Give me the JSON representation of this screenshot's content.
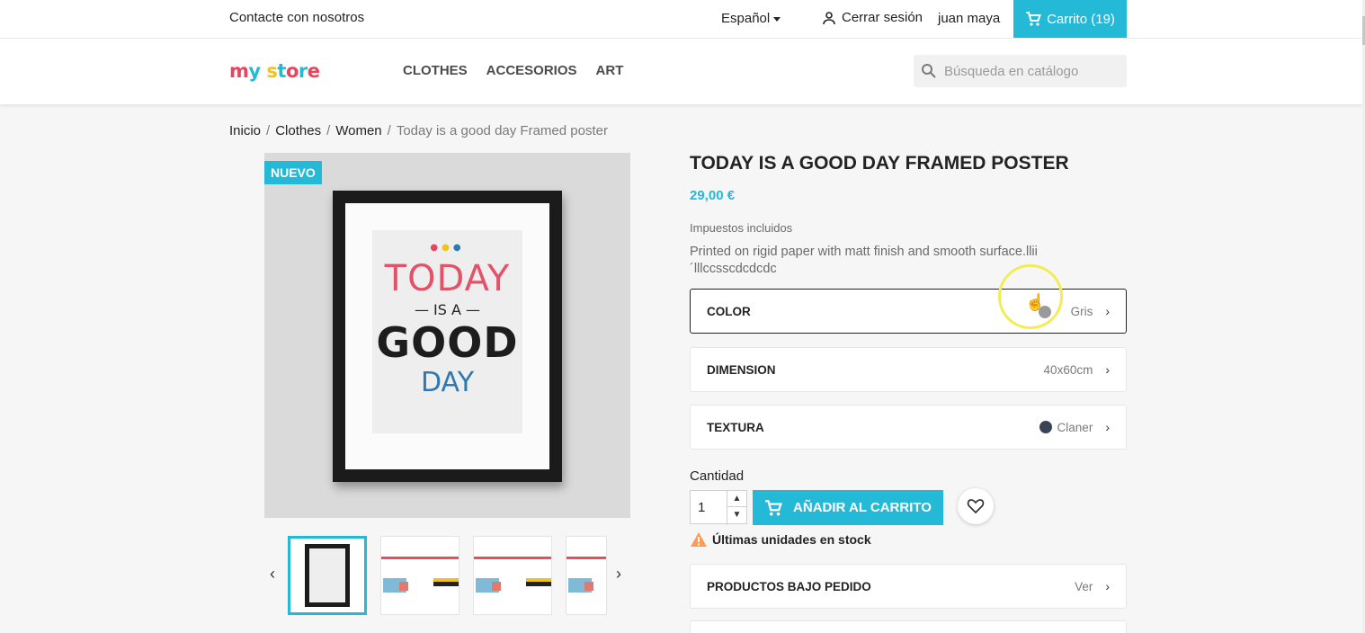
{
  "topbar": {
    "contact": "Contacte con nosotros",
    "language": "Español",
    "logout": "Cerrar sesión",
    "username": "juan maya",
    "cart": "Carrito (19)"
  },
  "header": {
    "logo": "my store",
    "nav": [
      "CLOTHES",
      "ACCESORIOS",
      "ART"
    ],
    "search_placeholder": "Búsqueda en catálogo"
  },
  "breadcrumb": [
    "Inicio",
    "Clothes",
    "Women",
    "Today is a good day Framed poster"
  ],
  "product": {
    "badge": "NUEVO",
    "title": "TODAY IS A GOOD DAY FRAMED POSTER",
    "price": "29,00 €",
    "tax": "Impuestos incluidos",
    "description_line1": "Printed on rigid paper with matt finish and smooth surface.llii",
    "description_line2": "´lllccsscdcdcdc",
    "artwork": {
      "line1": "TODAY",
      "line2": "— IS A —",
      "line3": "GOOD",
      "line4": "DAY"
    },
    "options": [
      {
        "label": "COLOR",
        "value": "Gris",
        "swatch": "#9a9a9a"
      },
      {
        "label": "DIMENSION",
        "value": "40x60cm"
      },
      {
        "label": "TEXTURA",
        "value": "Claner",
        "swatch": "#3b4356"
      }
    ],
    "quantity_label": "Cantidad",
    "quantity": "1",
    "add_to_cart": "AÑADIR AL CARRITO",
    "stock_warning": "Últimas unidades en stock",
    "backorder": {
      "label": "PRODUCTOS BAJO PEDIDO",
      "value": "Ver"
    }
  },
  "colors": {
    "accent": "#24b9d7",
    "logo_m": "#e5465d",
    "logo_y": "#24b9d7",
    "warning": "#ff9a52"
  },
  "icons": {
    "user": "user-icon",
    "cart": "cart-icon",
    "search": "search-icon",
    "heart": "heart-icon",
    "warning": "warning-icon"
  }
}
